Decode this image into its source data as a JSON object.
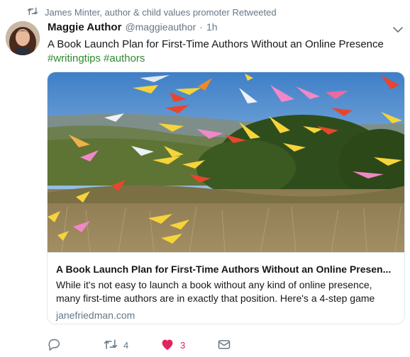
{
  "retweet_context": {
    "text": "James Minter, author & child values promoter Retweeted"
  },
  "tweet": {
    "author_name": "Maggie Author",
    "handle": "@maggieauthor",
    "separator": "·",
    "time": "1h",
    "text": "A Book Launch Plan for First-Time Authors Without an Online Presence",
    "hashtags": [
      "#writingtips",
      "#authors"
    ]
  },
  "card": {
    "title": "A Book Launch Plan for First-Time Authors Without an Online Presen...",
    "description": "While it's not easy to launch a book without any kind of online presence, many first-time authors are in exactly that position. Here's a 4-step game",
    "domain": "janefriedman.com"
  },
  "actions": {
    "reply_count": "",
    "retweet_count": "4",
    "like_count": "3",
    "liked": true
  },
  "colors": {
    "hashtag": "#2e8b2e",
    "muted": "#657786",
    "like": "#e0245e"
  }
}
